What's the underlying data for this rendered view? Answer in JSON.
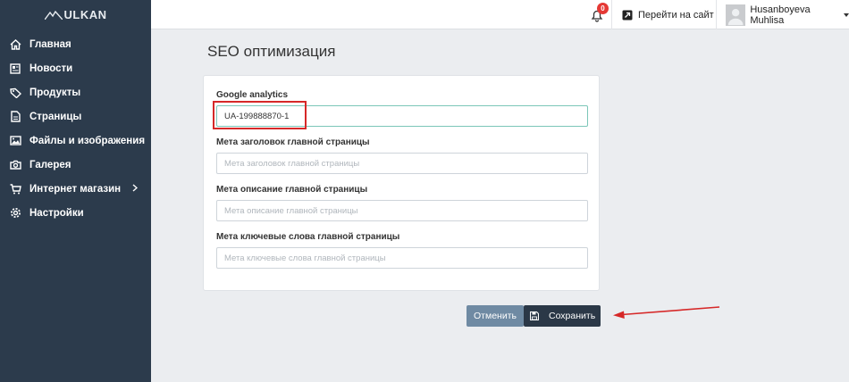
{
  "sidebar": {
    "logo": "ULKAN",
    "items": [
      {
        "label": "Главная",
        "icon": "home-icon"
      },
      {
        "label": "Новости",
        "icon": "newspaper-icon"
      },
      {
        "label": "Продукты",
        "icon": "tags-icon"
      },
      {
        "label": "Страницы",
        "icon": "file-icon"
      },
      {
        "label": "Файлы и изображения",
        "icon": "image-icon"
      },
      {
        "label": "Галерея",
        "icon": "camera-icon"
      },
      {
        "label": "Интернет магазин",
        "icon": "cart-icon"
      },
      {
        "label": "Настройки",
        "icon": "gear-icon"
      }
    ]
  },
  "topbar": {
    "notifications_count": "0",
    "goto_site": "Перейти на сайт",
    "user_name": "Husanboyeva Muhlisa"
  },
  "page": {
    "title": "SEO оптимизация"
  },
  "form": {
    "google_analytics_label": "Google analytics",
    "google_analytics_value": "UA-199888870-1",
    "meta_title_label": "Мета заголовок главной страницы",
    "meta_title_placeholder": "Мета заголовок главной страницы",
    "meta_desc_label": "Мета описание главной страницы",
    "meta_desc_placeholder": "Мета описание главной страницы",
    "meta_keywords_label": "Мета ключевые слова главной страницы",
    "meta_keywords_placeholder": "Мета ключевые слова главной страницы"
  },
  "actions": {
    "cancel": "Отменить",
    "save": "Сохранить"
  },
  "colors": {
    "sidebar_bg": "#2c3b4c",
    "highlight": "#d62828",
    "save_bg": "#2b3847",
    "cancel_bg": "#6f8aa3"
  }
}
